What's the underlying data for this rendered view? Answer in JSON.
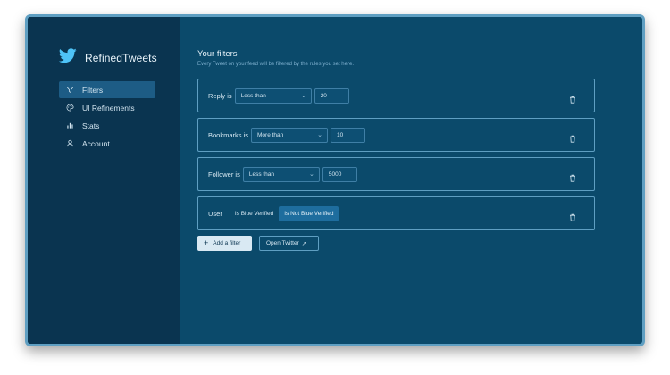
{
  "app": {
    "name": "RefinedTweets",
    "accent": "#4ec3f7"
  },
  "sidebar": {
    "items": [
      {
        "label": "Filters",
        "icon": "filter-icon",
        "active": true
      },
      {
        "label": "UI Refinements",
        "icon": "palette-icon",
        "active": false
      },
      {
        "label": "Stats",
        "icon": "bar-chart-icon",
        "active": false
      },
      {
        "label": "Account",
        "icon": "user-icon",
        "active": false
      }
    ]
  },
  "main": {
    "title": "Your filters",
    "subtitle": "Every Tweet on your feed will be filtered by the rules you set here.",
    "filters": [
      {
        "label": "Reply is",
        "operator": "Less than",
        "value": "20"
      },
      {
        "label": "Bookmarks is",
        "operator": "More than",
        "value": "10"
      },
      {
        "label": "Follower is",
        "operator": "Less than",
        "value": "5000"
      },
      {
        "label": "User",
        "options": [
          "Is Blue Verified",
          "Is Not Blue Verified"
        ],
        "selected": "Is Not Blue Verified"
      }
    ],
    "add_filter_label": "Add a filter",
    "open_twitter_label": "Open Twitter"
  }
}
